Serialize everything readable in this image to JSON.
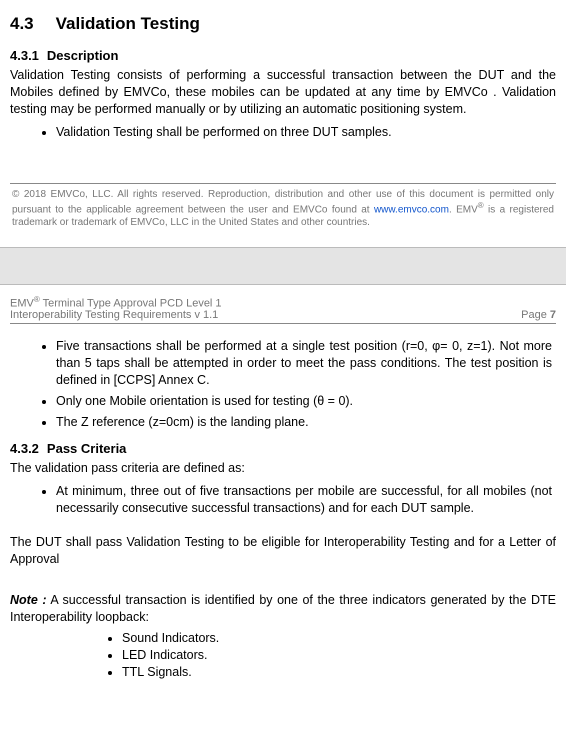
{
  "section": {
    "number": "4.3",
    "title": "Validation Testing"
  },
  "sub431": {
    "number": "4.3.1",
    "title": "Description",
    "para": "Validation Testing consists of performing a successful transaction between the DUT and the Mobiles defined by EMVCo, these mobiles can be updated at any time by EMVCo . Validation testing may be performed manually or by utilizing an automatic positioning system.",
    "bullet1": "Validation Testing shall be performed on three DUT samples."
  },
  "footer": {
    "text_pre": "© 2018 EMVCo, LLC. All rights reserved. Reproduction, distribution and other use of this document is permitted only pursuant to the applicable agreement between the user and EMVCo found at ",
    "link_text": "www.emvco.com",
    "text_post": ". EMV",
    "text_post2": " is a registered trademark or trademark of EMVCo, LLC in the United States and other countries."
  },
  "header": {
    "line1_pre": "EMV",
    "line1_post": " Terminal Type Approval PCD Level 1",
    "line2": "Interoperability Testing Requirements v 1.1",
    "page_label": "Page ",
    "page_num": "7"
  },
  "cont_bullets": {
    "b1": "Five transactions shall be performed at a single test position (r=0, φ= 0, z=1). Not more than 5 taps shall be attempted in order to meet the pass conditions. The test position is defined in [CCPS] Annex C.",
    "b2": "Only one Mobile orientation is used for testing (θ = 0).",
    "b3": "The Z reference (z=0cm) is the landing plane."
  },
  "sub432": {
    "number": "4.3.2",
    "title": "Pass Criteria",
    "para_intro": "The validation pass criteria are defined as:",
    "bullet1": "At minimum, three out of five transactions per mobile are successful, for all mobiles (not necessarily consecutive successful transactions) and for each DUT sample.",
    "para_eligible": "The DUT shall pass Validation Testing to be eligible for Interoperability Testing and for a Letter of Approval"
  },
  "note": {
    "label": "Note :",
    "body": "A successful transaction is identified by one of the three indicators generated by the DTE Interoperability loopback:",
    "i1": "Sound Indicators.",
    "i2": "LED Indicators.",
    "i3": "TTL Signals."
  }
}
